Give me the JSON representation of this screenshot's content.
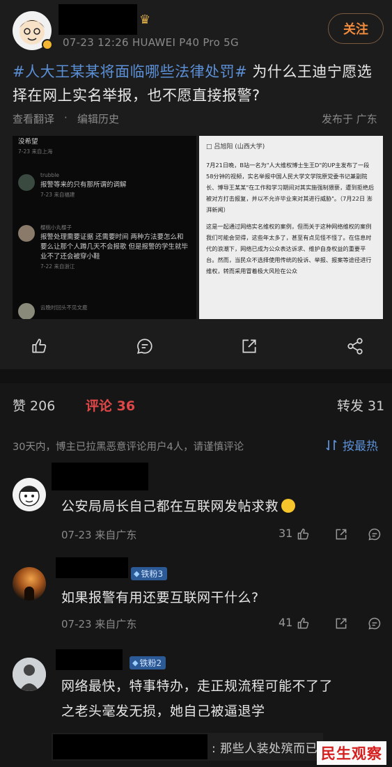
{
  "post": {
    "meta": "07-23 12:26   HUAWEI P40 Pro 5G",
    "follow_label": "关注",
    "hashtag": "#人大王某某将面临哪些法律处罚#",
    "text": " 为什么王迪宁愿选择在网上实名举报，也不愿直接报警?",
    "translate_label": "查看翻译",
    "history_label": "编辑历史",
    "location_label": "发布于 广东"
  },
  "thumb_left": {
    "rows": [
      {
        "text": "没希望",
        "meta": "7-23  来自上海"
      },
      {
        "user": "trubble",
        "text": "报警等来的只有那所谓的调解",
        "meta": "7-23  来自福建"
      },
      {
        "user": "樱桃小丸樱子",
        "text": "报警处理需要证据 还需要时间 两种方法要怎么和 要么让那个人蹲几天不会报歌 但是报警的学生就毕业不了还会被穿小鞋",
        "meta": "7-22  来自浙江"
      },
      {
        "user": "云晚时回头不见文鹿",
        "text": "",
        "meta": ""
      }
    ]
  },
  "thumb_right": {
    "author": "□ 吕旭阳 (山西大学)",
    "p1": "7月21日晚，B站一名为\"人大维权博士生王D\"的UP主发布了一段58分钟的视频，实名举报中国人民大学文学院原党委书记兼副院长、博导王某某\"在工作和学习期间对其实施强制猥亵，遭到拒绝后被对方打击报复，并以不允许毕业来对其进行威胁\"。（7月22日 澎湃新闻）",
    "p2": "这是一起通过网络实名维权的案例，但而关于这种网络维权的案例我们可能会觉得，这些年太多了，甚至有点见怪不怪了。在信息时代的浪潮下，网络已成为公众表达诉求、维护自身权益的重要平台。然而，当民众不选择使用传统的投诉、举报、报案等途径进行维权，转而采用冒着极大风险在公众"
  },
  "stats": {
    "likes_label": "赞 206",
    "comments_label": "评论 36",
    "reposts_label": "转发 31"
  },
  "notice": "30天内，博主已拉黑恶意评论用户4人，请谨慎评论",
  "sort_label": "按最热",
  "comments": [
    {
      "text": "公安局局长自己都在互联网发帖求救",
      "meta": "07-23  来自广东",
      "likes": "31",
      "badge": ""
    },
    {
      "text": "如果报警有用还要互联网干什么?",
      "meta": "07-23  来自广东",
      "likes": "41",
      "badge": "铁粉3"
    },
    {
      "text": "网络最快，特事特办，走正规流程可能不了了",
      "text2": "之老头毫发无损，她自己被逼退学",
      "meta": "",
      "likes": "",
      "badge": "铁粉2"
    }
  ],
  "reply_preview": ": 那些人装处殡而已",
  "watermark": "民生观察",
  "colors": {
    "accent_blue": "#5b8fd6",
    "comment_red": "#e04848",
    "follow_orange": "#f08a3c",
    "badge_blue": "#2c5a96"
  }
}
